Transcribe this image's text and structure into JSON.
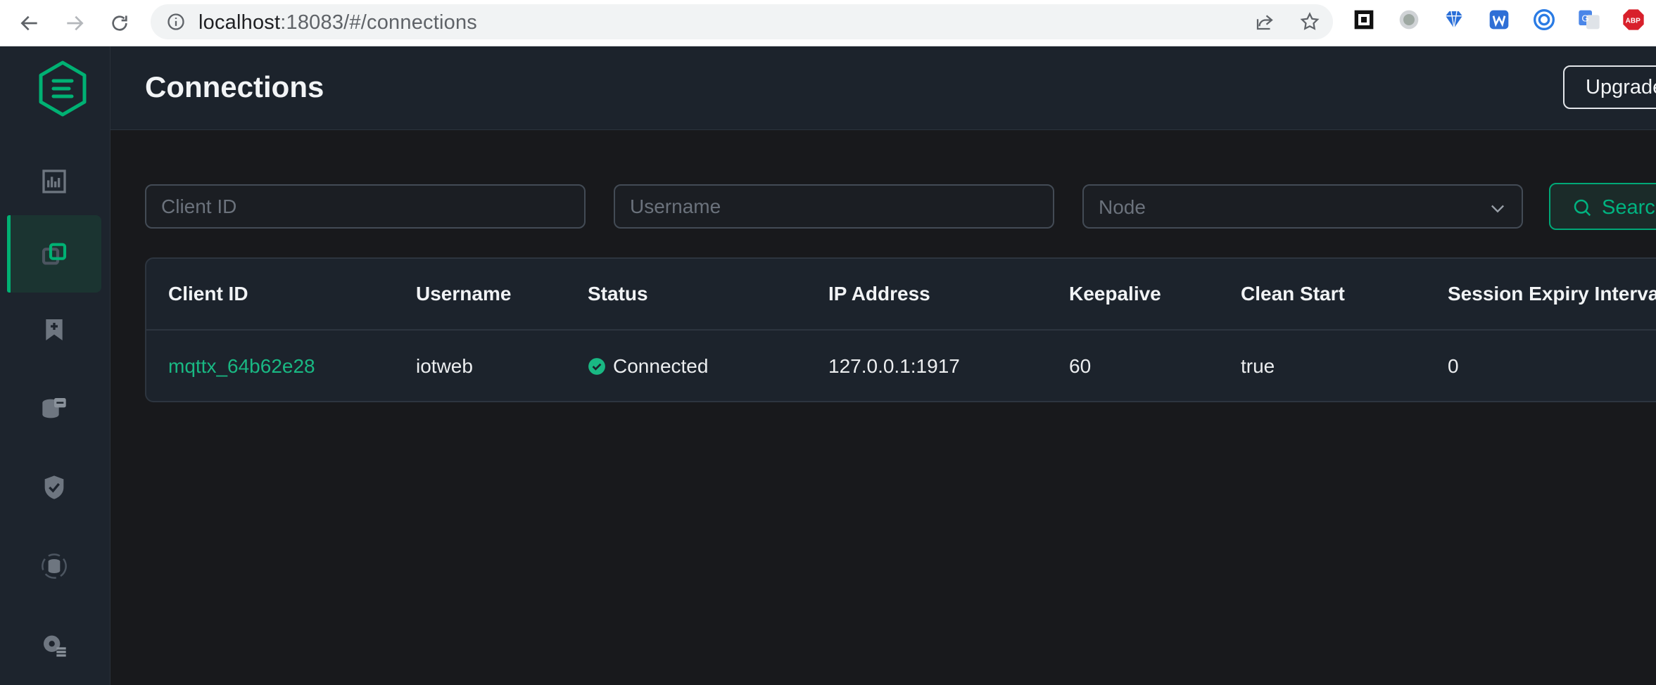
{
  "browser": {
    "url_host": "localhost",
    "url_rest": ":18083/#/connections"
  },
  "header": {
    "title": "Connections",
    "upgrade_label": "Upgrade"
  },
  "filters": {
    "client_id_placeholder": "Client ID",
    "username_placeholder": "Username",
    "node_placeholder": "Node",
    "search_label": "Search"
  },
  "table": {
    "columns": [
      "Client ID",
      "Username",
      "Status",
      "IP Address",
      "Keepalive",
      "Clean Start",
      "Session Expiry Interval"
    ],
    "rows": [
      {
        "client_id": "mqttx_64b62e28",
        "username": "iotweb",
        "status": "Connected",
        "ip_address": "127.0.0.1:1917",
        "keepalive": "60",
        "clean_start": "true",
        "session_expiry_interval": "0"
      }
    ]
  },
  "sidebar": {
    "items": [
      {
        "icon": "dashboard-icon",
        "active": false
      },
      {
        "icon": "connections-icon",
        "active": true
      },
      {
        "icon": "subscriptions-icon",
        "active": false
      },
      {
        "icon": "retained-messages-icon",
        "active": false
      },
      {
        "icon": "access-control-icon",
        "active": false
      },
      {
        "icon": "integration-icon",
        "active": false
      },
      {
        "icon": "management-icon",
        "active": false
      }
    ]
  },
  "colors": {
    "accent": "#00b173",
    "link": "#19b883",
    "sidebar_bg": "#1d242d",
    "page_bg": "#18191c"
  }
}
